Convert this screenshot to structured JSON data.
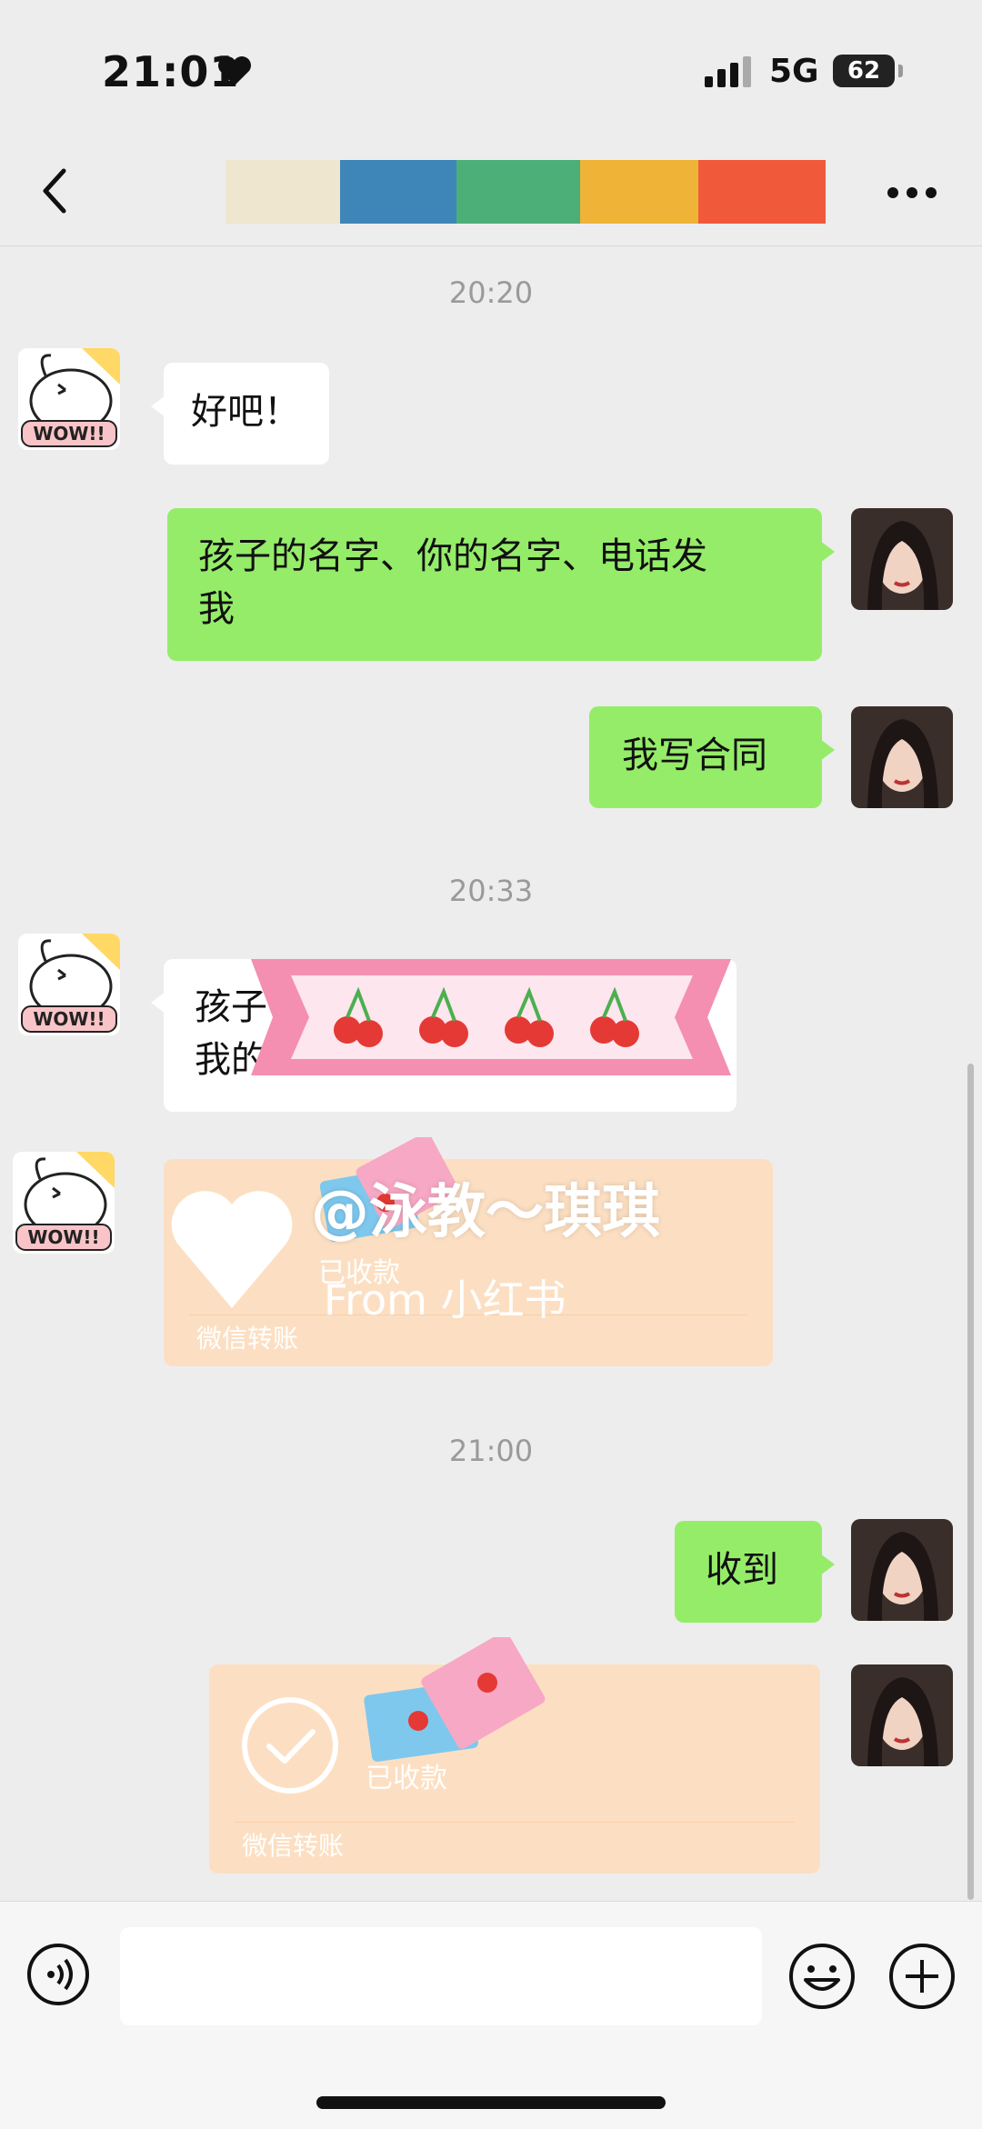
{
  "status_bar": {
    "time": "21:01",
    "network": "5G",
    "battery": "62"
  },
  "nav": {
    "back_icon": "chevron-left-icon",
    "more_icon": "ellipsis-icon",
    "title_censor_colors": [
      "#efe6cf",
      "#3e86b8",
      "#4caf78",
      "#efb338",
      "#f05a3a"
    ]
  },
  "messages": {
    "ts1": "20:20",
    "m1": "好吧！",
    "m2_line1": "孩子的名字、你的名字、电话发",
    "m2_line2": "我",
    "m3": "我写合同",
    "ts2": "20:33",
    "m4_line1": "孩子",
    "m4_line2": "我的",
    "transfer1": {
      "status": "已收款",
      "label": "微信转账"
    },
    "ts3": "21:00",
    "m5": "收到",
    "transfer2": {
      "status": "已收款",
      "label": "微信转账"
    }
  },
  "watermark": {
    "handle": "@泳教～琪琪",
    "source": "From 小红书"
  },
  "avatars": {
    "friend": "WOW!!",
    "me": "avatar-photo"
  },
  "colors": {
    "outgoing_bubble": "#95ec69",
    "incoming_bubble": "#ffffff",
    "transfer_bg": "#fcdfc2",
    "sticker_pink": "#f48fb1"
  },
  "input": {
    "placeholder": ""
  }
}
